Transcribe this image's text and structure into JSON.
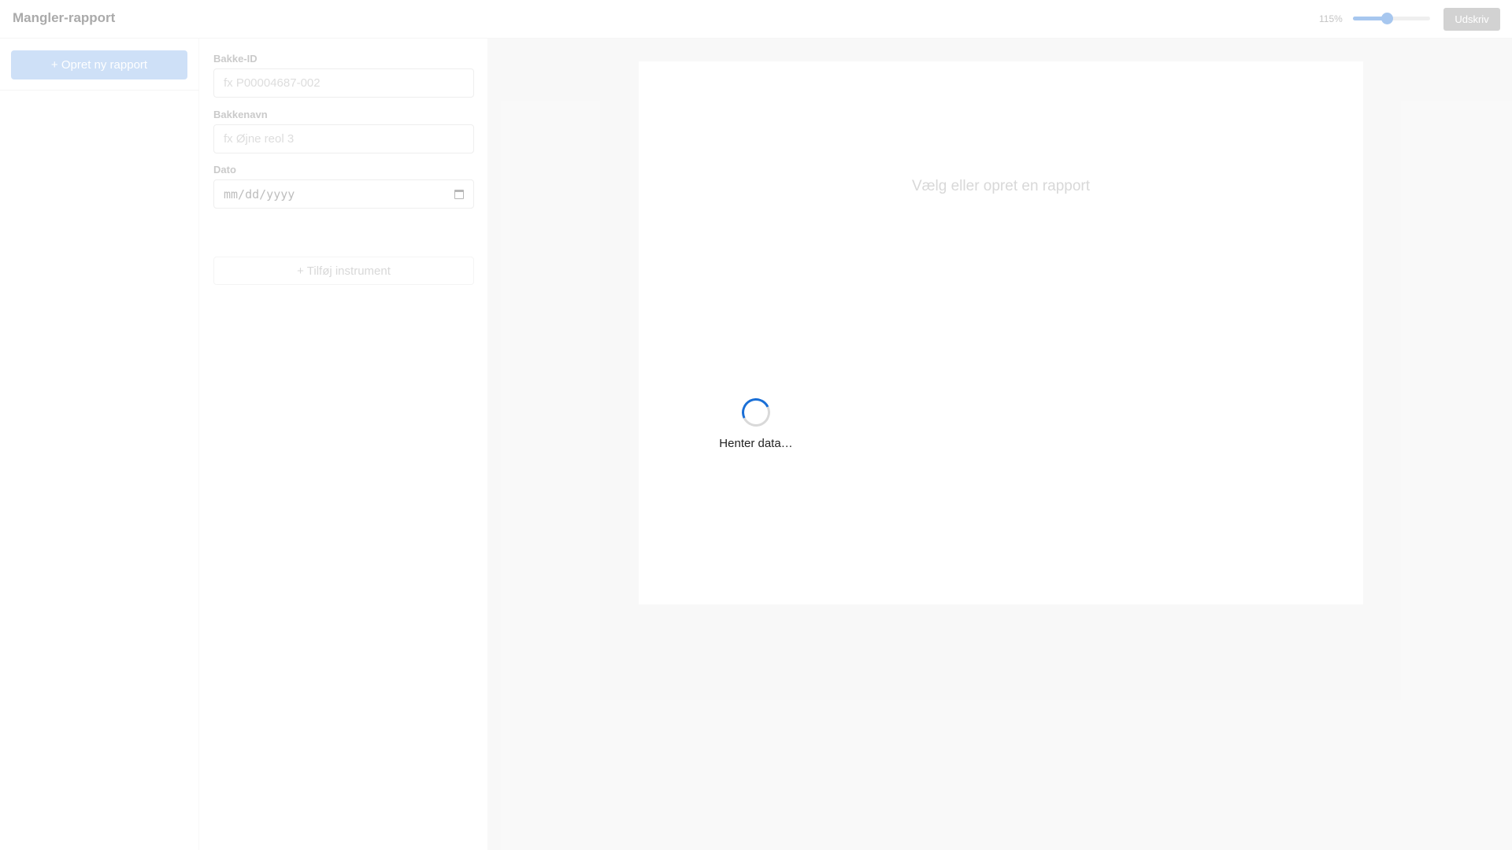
{
  "header": {
    "title": "Mangler-rapport",
    "zoom_label": "115%",
    "zoom_value_percent": 115,
    "print_label": "Udskriv"
  },
  "sidebar": {
    "new_report_label": "+ Opret ny rapport"
  },
  "form": {
    "tray_id": {
      "label": "Bakke-ID",
      "placeholder": "fx P00004687-002",
      "value": ""
    },
    "tray_name": {
      "label": "Bakkenavn",
      "placeholder": "fx Øjne reol 3",
      "value": ""
    },
    "date": {
      "label": "Dato",
      "placeholder": "mm/dd/yyyy",
      "value": ""
    },
    "add_instrument_label": "+ Tilføj instrument"
  },
  "preview": {
    "empty_message": "Vælg eller opret en rapport"
  },
  "loading": {
    "text": "Henter data…"
  },
  "colors": {
    "accent": "#1a6fd6",
    "preview_background": "#eeeeee"
  },
  "icons": {
    "calendar": "calendar-icon",
    "spinner": "loading-spinner-icon"
  }
}
